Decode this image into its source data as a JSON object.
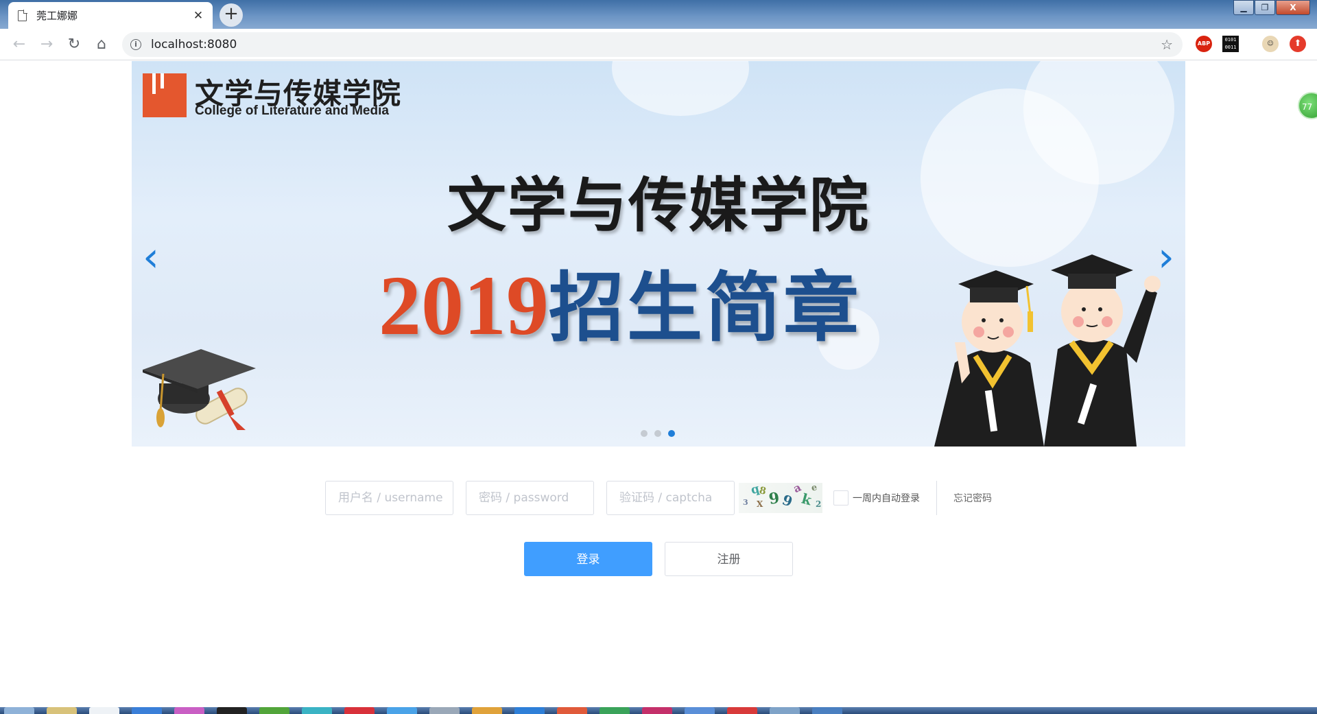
{
  "browser": {
    "tab_title": "莞工娜娜",
    "tab_close": "✕",
    "new_tab": "+",
    "url": "localhost:8080",
    "window_controls": {
      "minimize": "▁",
      "maximize": "❐",
      "close": "X"
    },
    "extensions": {
      "abp": "ABP",
      "binary": "0101\n0011"
    },
    "icons": [
      "back-icon",
      "forward-icon",
      "reload-icon",
      "home-icon",
      "info-icon",
      "star-icon"
    ]
  },
  "side_widget": {
    "value": "77"
  },
  "banner": {
    "logo_cn": "文学与传媒学院",
    "logo_en": "College of Literature and Media",
    "headline_1": "文学与传媒学院",
    "headline_year": "2019",
    "headline_rest": "招生简章",
    "prev_arrow": "‹",
    "next_arrow": "›",
    "slide_count": 3,
    "active_slide": 3,
    "colors": {
      "logo": "#e4572e",
      "year": "#de4a26",
      "title_blue": "#1d4f8e",
      "arrow": "#1f7ed8"
    }
  },
  "login": {
    "username_placeholder": "用户名 / username",
    "password_placeholder": "密码 / password",
    "captcha_placeholder": "验证码 / captcha",
    "captcha_chars": [
      "q",
      "8",
      "9",
      "9",
      "a",
      "k",
      "e",
      "3",
      "X",
      "2"
    ],
    "remember_label": "一周内自动登录",
    "forgot_label": "忘记密码",
    "login_button": "登录",
    "register_button": "注册",
    "accent": "#409eff"
  }
}
